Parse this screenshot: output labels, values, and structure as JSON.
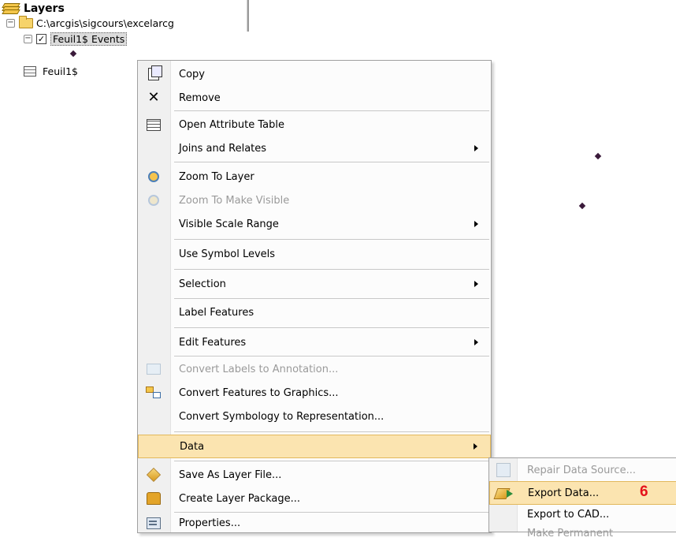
{
  "toc": {
    "title": "Layers",
    "path": "C:\\arcgis\\sigcours\\excelarcg",
    "layer_name": "Feuil1$ Events",
    "table_name": "Feuil1$"
  },
  "context_menu": {
    "items": [
      {
        "label": "Copy",
        "icon": "copy-icon",
        "enabled": true,
        "submenu": false
      },
      {
        "label": "Remove",
        "icon": "remove-icon",
        "enabled": true,
        "submenu": false
      },
      {
        "label": "Open Attribute Table",
        "icon": "attribute-table-icon",
        "enabled": true,
        "submenu": false
      },
      {
        "label": "Joins and Relates",
        "icon": "",
        "enabled": true,
        "submenu": true
      },
      {
        "label": "Zoom To Layer",
        "icon": "zoom-to-layer-icon",
        "enabled": true,
        "submenu": false
      },
      {
        "label": "Zoom To Make Visible",
        "icon": "zoom-to-make-visible-icon",
        "enabled": false,
        "submenu": false
      },
      {
        "label": "Visible Scale Range",
        "icon": "",
        "enabled": true,
        "submenu": true
      },
      {
        "label": "Use Symbol Levels",
        "icon": "",
        "enabled": true,
        "submenu": false
      },
      {
        "label": "Selection",
        "icon": "",
        "enabled": true,
        "submenu": true
      },
      {
        "label": "Label Features",
        "icon": "",
        "enabled": true,
        "submenu": false
      },
      {
        "label": "Edit Features",
        "icon": "",
        "enabled": true,
        "submenu": true
      },
      {
        "label": "Convert Labels to Annotation...",
        "icon": "convert-labels-icon",
        "enabled": false,
        "submenu": false
      },
      {
        "label": "Convert Features to Graphics...",
        "icon": "convert-graphics-icon",
        "enabled": true,
        "submenu": false
      },
      {
        "label": "Convert Symbology to Representation...",
        "icon": "",
        "enabled": true,
        "submenu": false
      },
      {
        "label": "Data",
        "icon": "",
        "enabled": true,
        "submenu": true,
        "highlighted": true
      },
      {
        "label": "Save As Layer File...",
        "icon": "layer-file-icon",
        "enabled": true,
        "submenu": false
      },
      {
        "label": "Create Layer Package...",
        "icon": "layer-package-icon",
        "enabled": true,
        "submenu": false
      },
      {
        "label": "Properties...",
        "icon": "properties-icon",
        "enabled": true,
        "submenu": false
      }
    ]
  },
  "data_submenu": {
    "items": [
      {
        "label": "Repair Data Source...",
        "icon": "repair-data-icon",
        "enabled": false
      },
      {
        "label": "Export Data...",
        "icon": "export-data-icon",
        "enabled": true,
        "highlighted": true
      },
      {
        "label": "Export to CAD...",
        "icon": "",
        "enabled": true
      },
      {
        "label": "Make Permanent",
        "icon": "",
        "enabled": false
      }
    ],
    "step_badge": "6"
  },
  "colors": {
    "highlight": "#fbe4b0",
    "highlight_border": "#e2b85c",
    "disabled_text": "#9a9a9a",
    "badge": "#e4121b",
    "map_point": "#3a1a3a"
  }
}
